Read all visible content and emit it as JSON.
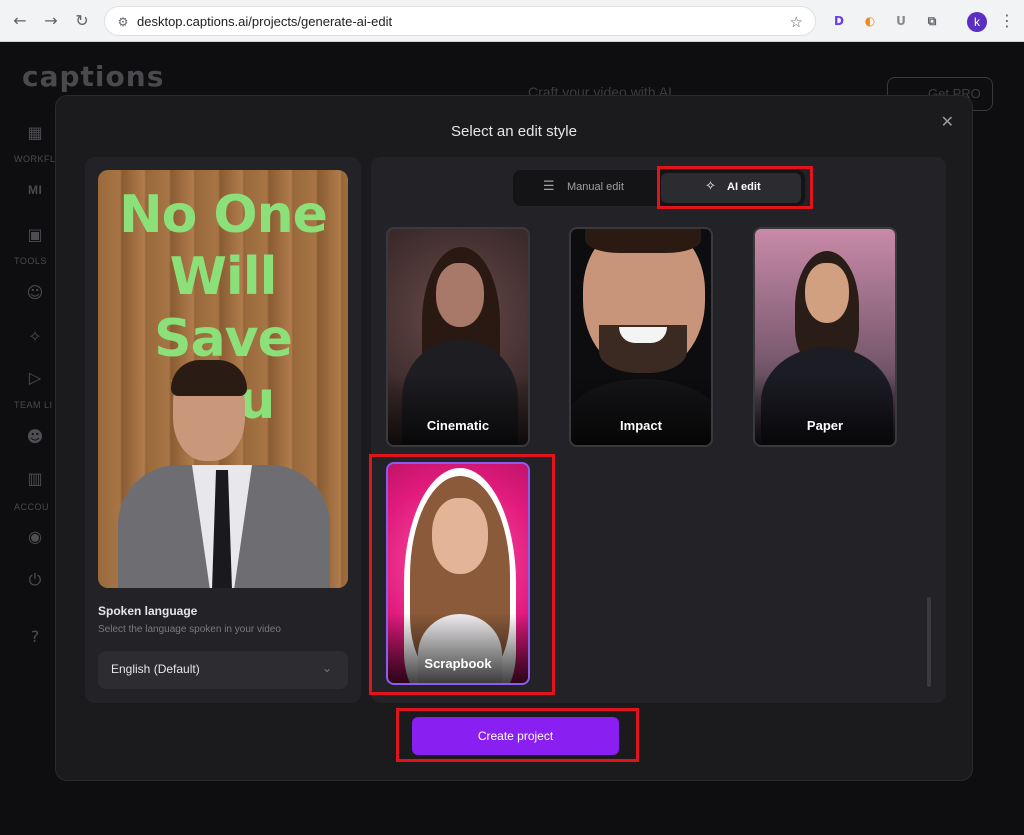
{
  "browser": {
    "url": "desktop.captions.ai/projects/generate-ai-edit",
    "avatar_letter": "k"
  },
  "app": {
    "logo": "captions",
    "sidebar_labels": [
      "WORKFL",
      "MI",
      "TOOLS",
      "TEAM LI",
      "ACCOU"
    ],
    "background_title": "Craft your video with AI",
    "background_pro": "Get PRO"
  },
  "modal": {
    "title": "Select an edit style",
    "preview_caption": "No One Will Save You",
    "language": {
      "title": "Spoken language",
      "subtitle": "Select the language spoken in your video",
      "value": "English (Default)"
    },
    "toggle": {
      "manual_label": "Manual edit",
      "ai_label": "AI edit",
      "selected": "AI edit"
    },
    "styles": [
      {
        "label": "Cinematic"
      },
      {
        "label": "Impact"
      },
      {
        "label": "Paper"
      },
      {
        "label": "Scrapbook"
      }
    ],
    "selected_style": "Scrapbook",
    "create_label": "Create project"
  },
  "colors": {
    "accent": "#8a1ff2",
    "highlight": "#e0141c",
    "caption_green": "#8be07a"
  }
}
